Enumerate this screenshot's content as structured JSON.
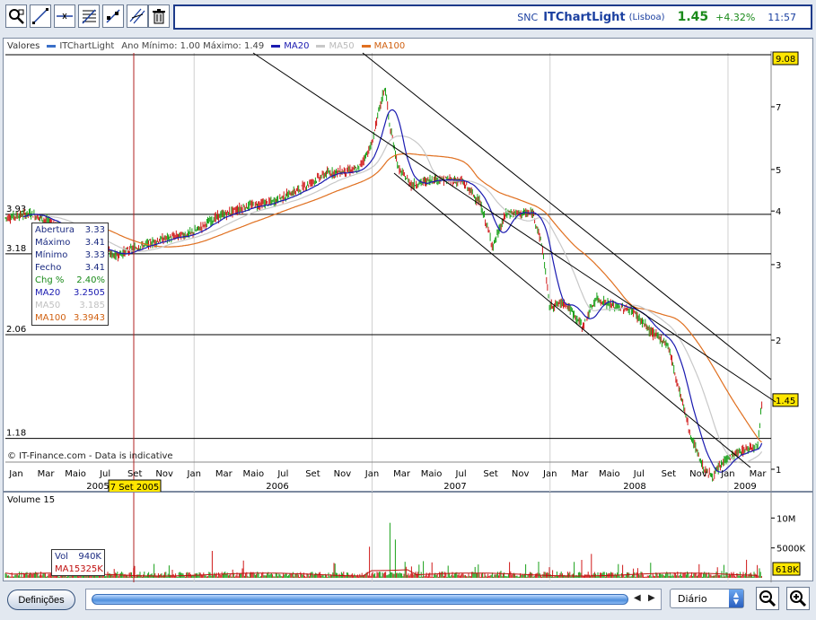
{
  "header": {
    "ticker": "SNC",
    "app_name": "ITChartLight",
    "exchange": "(Lisboa)",
    "price": "1.45",
    "change": "+4.32%",
    "time": "11:57"
  },
  "toolbar": {
    "tools": [
      "zoom-select-icon",
      "trend-line-icon",
      "horizontal-line-icon",
      "fibonacci-icon",
      "crosshair-icon",
      "parallel-channel-icon",
      "trash-icon"
    ]
  },
  "legend": {
    "label": "Valores",
    "series": [
      {
        "name": "ITChartLight",
        "color": "#3a6fc8"
      },
      {
        "name": "MA20",
        "color": "#1a1ab0"
      },
      {
        "name": "MA50",
        "color": "#c8c8c8"
      },
      {
        "name": "MA100",
        "color": "#e07020"
      }
    ],
    "range_text": "Ano Mínimo: 1.00 Máximo: 1.49"
  },
  "info_box": {
    "rows": [
      {
        "label": "Abertura",
        "value": "3.33",
        "color": "#1a2a80"
      },
      {
        "label": "Máximo",
        "value": "3.41",
        "color": "#1a2a80"
      },
      {
        "label": "Mínimo",
        "value": "3.33",
        "color": "#1a2a80"
      },
      {
        "label": "Fecho",
        "value": "3.41",
        "color": "#1a2a80"
      },
      {
        "label": "Chg %",
        "value": "2.40%",
        "color": "#1a8a1a"
      },
      {
        "label": "MA20",
        "value": "3.2505",
        "color": "#1a1ab0"
      },
      {
        "label": "MA50",
        "value": "3.185",
        "color": "#c0c0c0"
      },
      {
        "label": "MA100",
        "value": "3.3943",
        "color": "#d06010"
      }
    ]
  },
  "copyright": "© IT-Finance.com - Data is indicative",
  "cursor_date": "7 Set 2005",
  "y_axis_right": [
    "9.08",
    "7",
    "5",
    "4",
    "3",
    "2",
    "1.45",
    "1"
  ],
  "y_axis_left": [
    "3.93",
    "3.18",
    "2.06",
    "1.18"
  ],
  "x_axis_months": [
    "Jan",
    "Mar",
    "Maio",
    "Jul",
    "Set",
    "Nov",
    "Jan",
    "Mar",
    "Maio",
    "Jul",
    "Set",
    "Nov",
    "Jan",
    "Mar",
    "Maio",
    "Jul",
    "Set",
    "Nov",
    "Jan",
    "Mar",
    "Maio",
    "Jul",
    "Set",
    "Nov",
    "Jan",
    "Mar"
  ],
  "x_axis_years": [
    "2005",
    "2006",
    "2007",
    "2008",
    "2009"
  ],
  "volume": {
    "title": "Volume 15",
    "axis": [
      "10M",
      "5000K",
      "618K"
    ],
    "vol_label": "Vol",
    "vol_value": "940K",
    "ma_label": "MA15",
    "ma_value": "325K"
  },
  "bottom": {
    "settings_button": "Definições",
    "period_select": "Diário"
  },
  "colors": {
    "up": "#18a018",
    "down": "#d01818",
    "ma20": "#1a1ab0",
    "ma50": "#c8c8c8",
    "ma100": "#e07020"
  }
}
